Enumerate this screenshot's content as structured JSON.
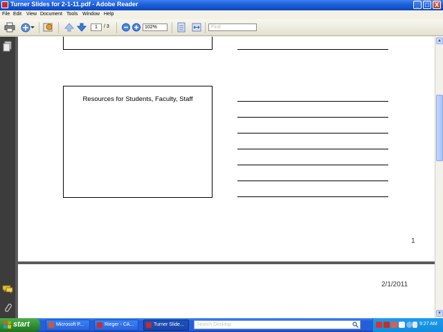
{
  "window": {
    "title": "Turner Slides for 2-1-11.pdf - Adobe Reader",
    "controls": [
      "_",
      "□",
      "X"
    ]
  },
  "menu": [
    "File",
    "Edit",
    "View",
    "Document",
    "Tools",
    "Window",
    "Help"
  ],
  "toolbar": {
    "current_page": "1",
    "page_total": "/ 3",
    "zoom": "102%",
    "find_placeholder": "Find"
  },
  "document": {
    "slide_title": "Resources for Students, Faculty, Staff",
    "page_number": "1",
    "date": "2/1/2011"
  },
  "taskbar": {
    "start_label": "start",
    "buttons": [
      {
        "label": "Microsoft P...",
        "icon_color": "#D2582A"
      },
      {
        "label": "Rieger - CA...",
        "icon_color": "#C9302C"
      },
      {
        "label": "Turner Slide...",
        "icon_color": "#C62B2B"
      }
    ],
    "search_placeholder": "Search Desktop",
    "clock": "9:27 AM"
  },
  "colors": {
    "titlebar": "#245EDB",
    "document_background": "#5A5A5A",
    "taskbar": "#245EDB",
    "start_button": "#2E8B2E"
  }
}
